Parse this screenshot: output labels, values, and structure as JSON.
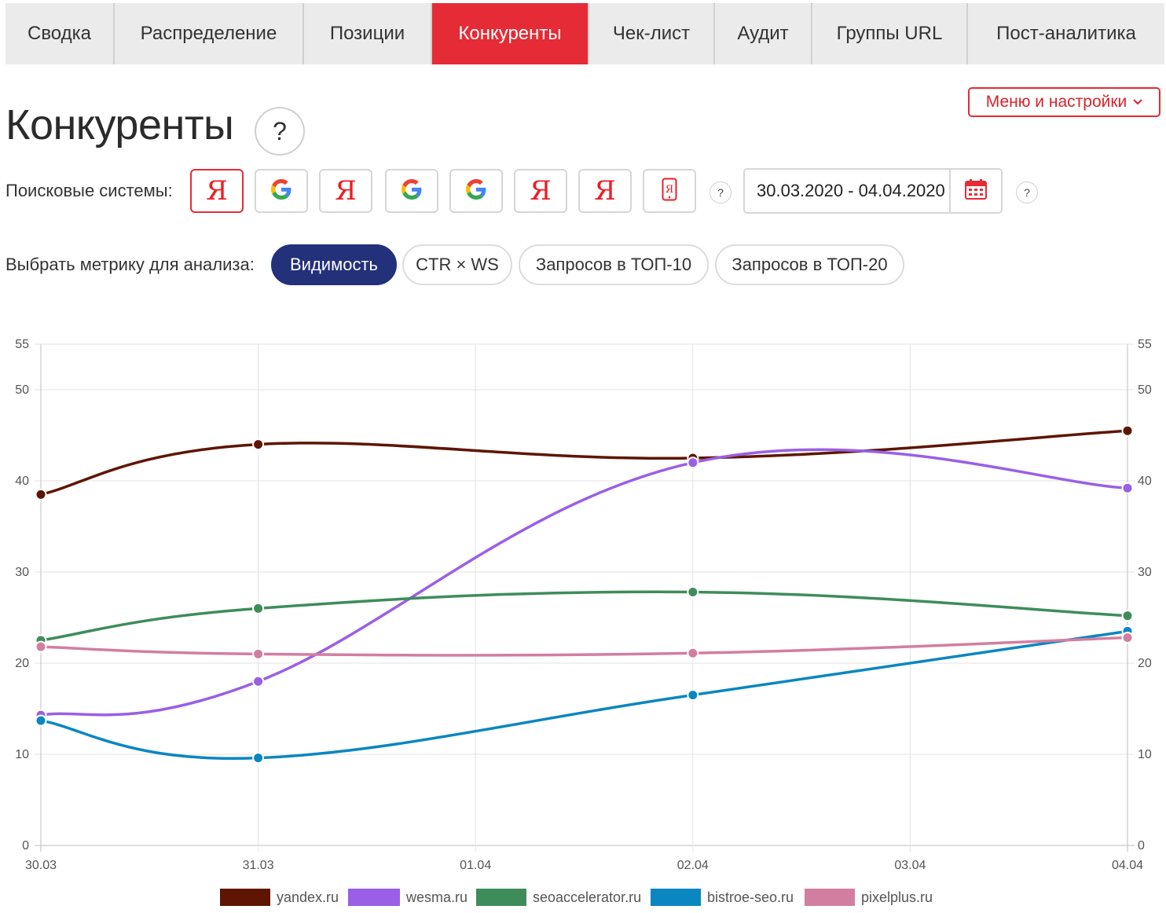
{
  "tabs": [
    {
      "label": "Сводка",
      "active": false
    },
    {
      "label": "Распределение",
      "active": false
    },
    {
      "label": "Позиции",
      "active": false
    },
    {
      "label": "Конкуренты",
      "active": true
    },
    {
      "label": "Чек-лист",
      "active": false
    },
    {
      "label": "Аудит",
      "active": false
    },
    {
      "label": "Группы URL",
      "active": false
    },
    {
      "label": "Пост-аналитика",
      "active": false
    }
  ],
  "menu_button": {
    "label": "Меню и настройки",
    "icon": "chevron-down-icon"
  },
  "page": {
    "title": "Конкуренты",
    "help": "?"
  },
  "search_engines": {
    "label": "Поисковые системы:",
    "items": [
      {
        "icon": "yandex-icon",
        "active": true
      },
      {
        "icon": "google-icon",
        "active": false
      },
      {
        "icon": "yandex-icon",
        "active": false
      },
      {
        "icon": "google-icon",
        "active": false
      },
      {
        "icon": "google-icon",
        "active": false
      },
      {
        "icon": "yandex-icon",
        "active": false
      },
      {
        "icon": "yandex-icon",
        "active": false
      },
      {
        "icon": "yandex-mobile-icon",
        "active": false
      }
    ],
    "help": "?"
  },
  "date_range": {
    "value": "30.03.2020 - 04.04.2020",
    "icon": "calendar-icon",
    "help": "?"
  },
  "metrics": {
    "label": "Выбрать метрику для анализа:",
    "options": [
      {
        "label": "Видимость",
        "active": true
      },
      {
        "label": "CTR × WS",
        "active": false
      },
      {
        "label": "Запросов в ТОП-10",
        "active": false
      },
      {
        "label": "Запросов в ТОП-20",
        "active": false
      }
    ]
  },
  "colors": {
    "accent": "#e52b35",
    "metric_active": "#23307a"
  },
  "chart_data": {
    "type": "line",
    "x": [
      "30.03",
      "31.03",
      "01.04",
      "02.04",
      "03.04",
      "04.04"
    ],
    "y_ticks": [
      0,
      10,
      20,
      30,
      40,
      50,
      55
    ],
    "ylim": [
      0,
      55
    ],
    "grid": true,
    "legend_position": "bottom",
    "series": [
      {
        "name": "yandex.ru",
        "color": "#5e1500",
        "points": [
          [
            0,
            38.5
          ],
          [
            1,
            44
          ],
          [
            3,
            42.5
          ],
          [
            5,
            45.5
          ]
        ]
      },
      {
        "name": "wesma.ru",
        "color": "#9a5fe6",
        "points": [
          [
            0,
            14.3
          ],
          [
            1,
            18
          ],
          [
            3,
            42
          ],
          [
            5,
            39.2
          ]
        ]
      },
      {
        "name": "seoaccelerator.ru",
        "color": "#3f8c5b",
        "points": [
          [
            0,
            22.5
          ],
          [
            1,
            26
          ],
          [
            3,
            27.8
          ],
          [
            5,
            25.2
          ]
        ]
      },
      {
        "name": "bistroe-seo.ru",
        "color": "#0a86c1",
        "points": [
          [
            0,
            13.7
          ],
          [
            1,
            9.6
          ],
          [
            3,
            16.5
          ],
          [
            5,
            23.5
          ]
        ]
      },
      {
        "name": "pixelplus.ru",
        "color": "#d27ea0",
        "points": [
          [
            0,
            21.8
          ],
          [
            1,
            21
          ],
          [
            3,
            21.1
          ],
          [
            5,
            22.8
          ]
        ]
      }
    ]
  }
}
